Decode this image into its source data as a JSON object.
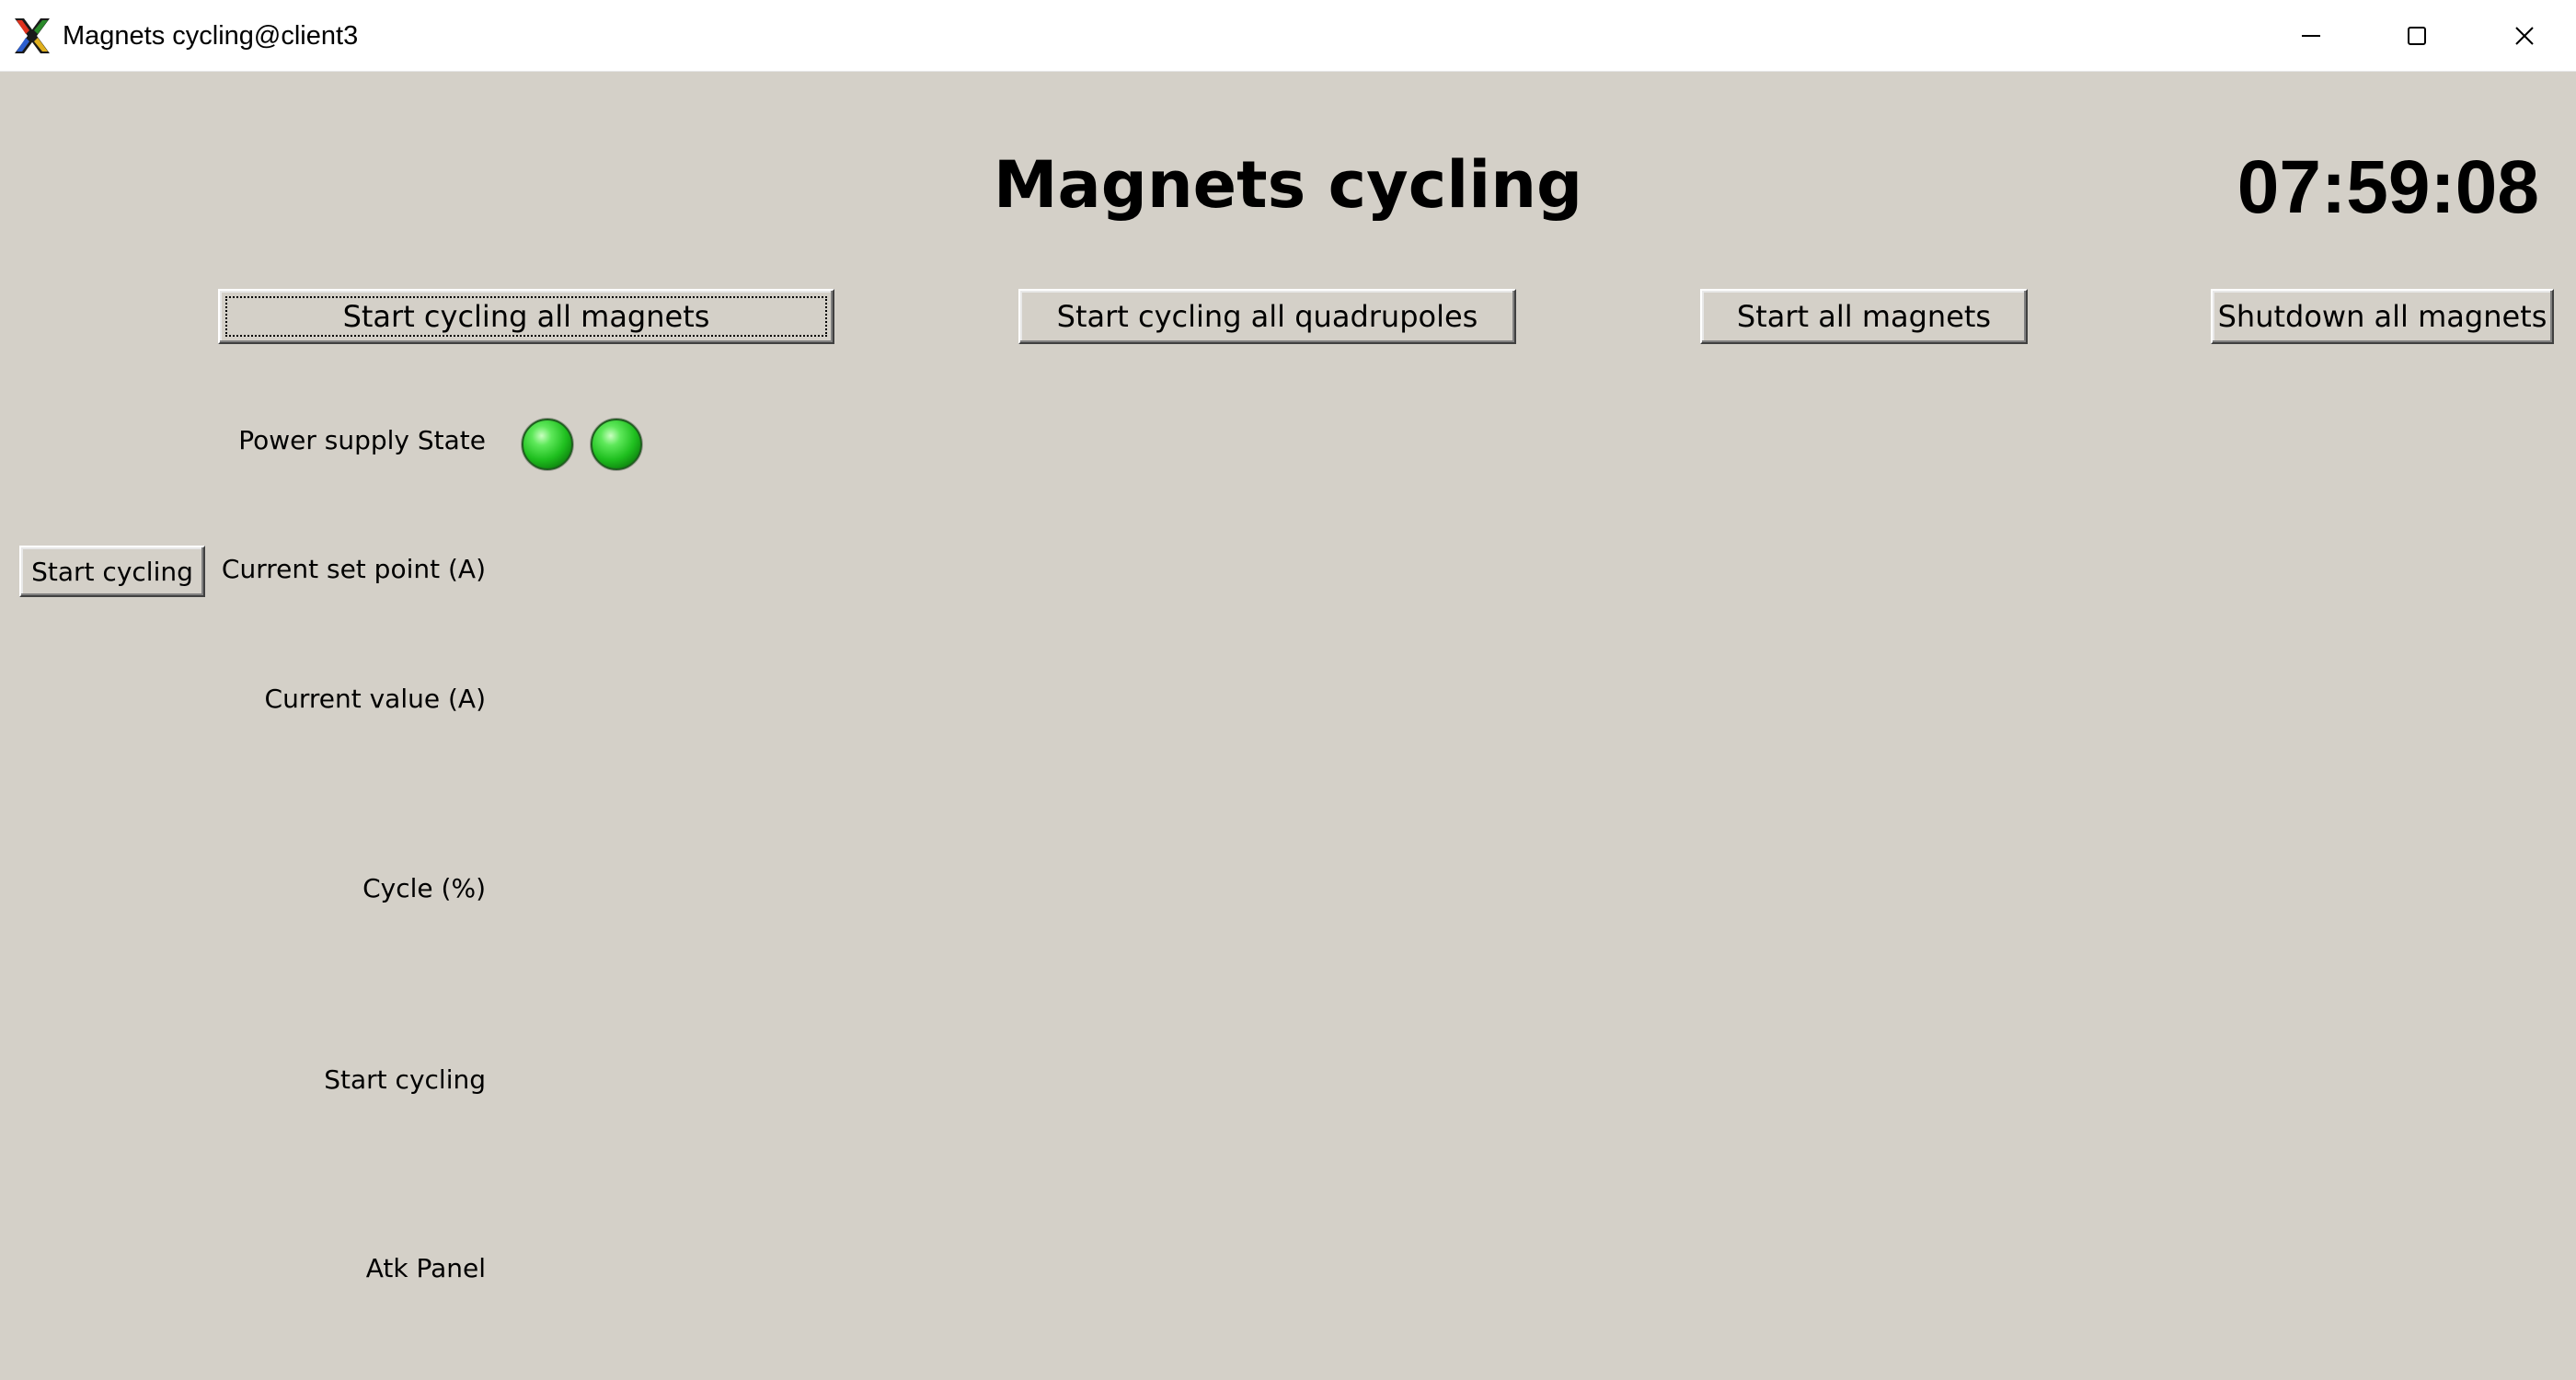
{
  "window": {
    "title": "Magnets cycling@client3",
    "icon": "x-app-icon",
    "controls": [
      "minimize-icon",
      "maximize-icon",
      "close-icon"
    ]
  },
  "header": {
    "title": "Magnets cycling",
    "clock": "07:59:08"
  },
  "actions": {
    "start_cycling_all_magnets": "Start cycling all magnets",
    "start_cycling_all_quadrupoles": "Start cycling all quadrupoles",
    "start_all_magnets": "Start all magnets",
    "shutdown_all_magnets": "Shutdown all magnets"
  },
  "rows": {
    "power_supply_state": {
      "label": "Power supply State",
      "leds": [
        {
          "state": "on",
          "color": "#1fbf1f"
        },
        {
          "state": "on",
          "color": "#1fbf1f"
        }
      ]
    },
    "current_set_point": {
      "label": "Current set point (A)",
      "button": "Start cycling"
    },
    "current_value": {
      "label": "Current value (A)"
    },
    "cycle": {
      "label": "Cycle (%)"
    },
    "start_cycling": {
      "label": "Start cycling"
    },
    "atk_panel": {
      "label": "Atk Panel"
    }
  },
  "colors": {
    "background": "#d4d0c8",
    "titlebar": "#ffffff",
    "led_on": "#1fbf1f"
  }
}
